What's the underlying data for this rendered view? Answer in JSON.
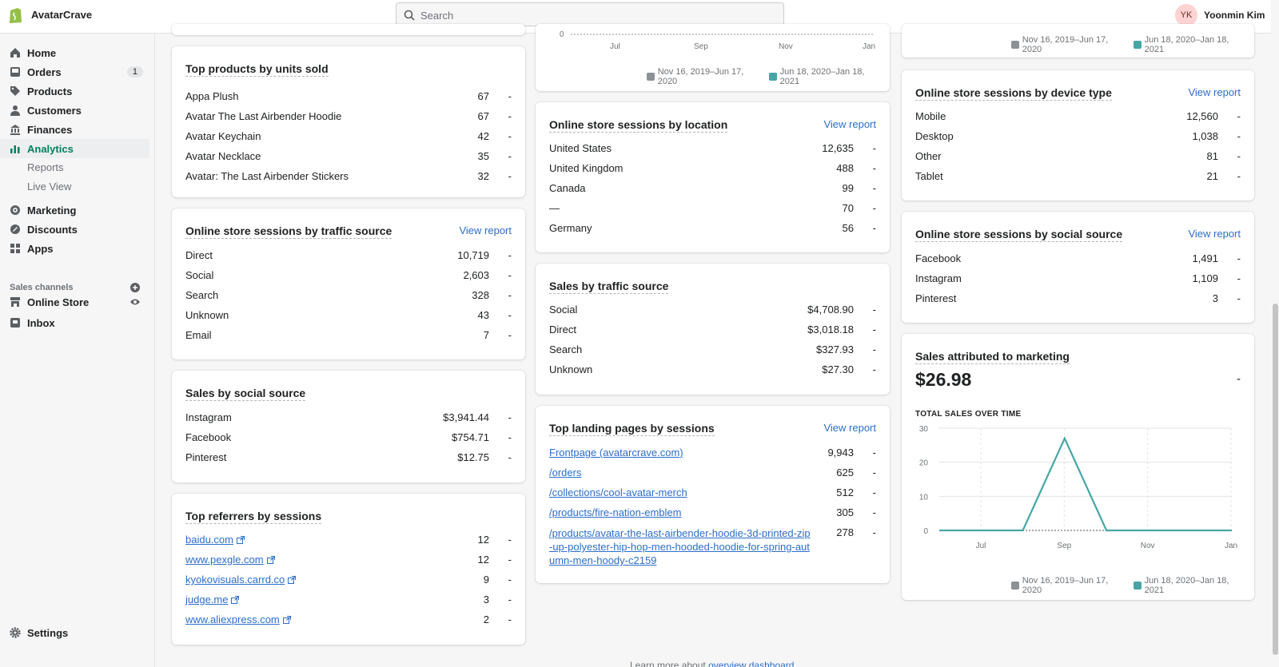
{
  "app": {
    "store_name": "AvatarCrave",
    "search_placeholder": "Search",
    "user_initials": "YK",
    "user_name": "Yoonmin Kim"
  },
  "sidebar": {
    "items": [
      {
        "label": "Home"
      },
      {
        "label": "Orders",
        "badge": "1"
      },
      {
        "label": "Products"
      },
      {
        "label": "Customers"
      },
      {
        "label": "Finances"
      },
      {
        "label": "Analytics"
      },
      {
        "label": "Marketing"
      },
      {
        "label": "Discounts"
      },
      {
        "label": "Apps"
      }
    ],
    "analytics_sub": [
      "Reports",
      "Live View"
    ],
    "channels_header": "Sales channels",
    "channels": [
      {
        "label": "Online Store"
      },
      {
        "label": "Inbox"
      }
    ],
    "settings": "Settings"
  },
  "common": {
    "view_report": "View report",
    "dash": "-"
  },
  "legend": {
    "prev": "Nov 16, 2019–Jun 17, 2020",
    "curr": "Jun 18, 2020–Jan 18, 2021",
    "prev_color": "#8c9196",
    "curr_color": "#47a5a5"
  },
  "top_chart": {
    "y_zero": "0",
    "x_ticks": [
      "Jul",
      "Sep",
      "Nov",
      "Jan"
    ]
  },
  "top_products": {
    "title": "Top products by units sold",
    "rows": [
      {
        "name": "Appa Plush",
        "value": "67"
      },
      {
        "name": "Avatar The Last Airbender Hoodie",
        "value": "67"
      },
      {
        "name": "Avatar Keychain",
        "value": "42"
      },
      {
        "name": "Avatar Necklace",
        "value": "35"
      },
      {
        "name": "Avatar: The Last Airbender Stickers",
        "value": "32"
      }
    ]
  },
  "traffic_sessions": {
    "title": "Online store sessions by traffic source",
    "rows": [
      {
        "name": "Direct",
        "value": "10,719"
      },
      {
        "name": "Social",
        "value": "2,603"
      },
      {
        "name": "Search",
        "value": "328"
      },
      {
        "name": "Unknown",
        "value": "43"
      },
      {
        "name": "Email",
        "value": "7"
      }
    ]
  },
  "social_sales": {
    "title": "Sales by social source",
    "rows": [
      {
        "name": "Instagram",
        "value": "$3,941.44"
      },
      {
        "name": "Facebook",
        "value": "$754.71"
      },
      {
        "name": "Pinterest",
        "value": "$12.75"
      }
    ]
  },
  "referrers": {
    "title": "Top referrers by sessions",
    "rows": [
      {
        "name": "baidu.com",
        "value": "12"
      },
      {
        "name": "www.pexgle.com",
        "value": "12"
      },
      {
        "name": "kyokovisuals.carrd.co",
        "value": "9"
      },
      {
        "name": "judge.me",
        "value": "3"
      },
      {
        "name": "www.aliexpress.com",
        "value": "2"
      }
    ]
  },
  "location_sessions": {
    "title": "Online store sessions by location",
    "rows": [
      {
        "name": "United States",
        "value": "12,635"
      },
      {
        "name": "United Kingdom",
        "value": "488"
      },
      {
        "name": "Canada",
        "value": "99"
      },
      {
        "name": "—",
        "value": "70"
      },
      {
        "name": "Germany",
        "value": "56"
      }
    ]
  },
  "traffic_sales": {
    "title": "Sales by traffic source",
    "rows": [
      {
        "name": "Social",
        "value": "$4,708.90"
      },
      {
        "name": "Direct",
        "value": "$3,018.18"
      },
      {
        "name": "Search",
        "value": "$327.93"
      },
      {
        "name": "Unknown",
        "value": "$27.30"
      }
    ]
  },
  "landing_pages": {
    "title": "Top landing pages by sessions",
    "rows": [
      {
        "name": "Frontpage (avatarcrave.com)",
        "value": "9,943"
      },
      {
        "name": "/orders",
        "value": "625"
      },
      {
        "name": "/collections/cool-avatar-merch",
        "value": "512"
      },
      {
        "name": "/products/fire-nation-emblem",
        "value": "305"
      },
      {
        "name": "/products/avatar-the-last-airbender-hoodie-3d-printed-zip-up-polyester-hip-hop-men-hooded-hoodie-for-spring-autumn-men-hoody-c2159",
        "lines": [
          "/products/avatar-the-last-airbender-hoodie-3d-printed-zip",
          "-up-polyester-hip-hop-men-hooded-hoodie-for-spring-aut",
          "umn-men-hoody-c2159"
        ],
        "value": "278"
      }
    ]
  },
  "device_sessions": {
    "title": "Online store sessions by device type",
    "rows": [
      {
        "name": "Mobile",
        "value": "12,560"
      },
      {
        "name": "Desktop",
        "value": "1,038"
      },
      {
        "name": "Other",
        "value": "81"
      },
      {
        "name": "Tablet",
        "value": "21"
      }
    ]
  },
  "social_sessions": {
    "title": "Online store sessions by social source",
    "rows": [
      {
        "name": "Facebook",
        "value": "1,491"
      },
      {
        "name": "Instagram",
        "value": "1,109"
      },
      {
        "name": "Pinterest",
        "value": "3"
      }
    ]
  },
  "marketing": {
    "title": "Sales attributed to marketing",
    "total": "$26.98",
    "change": "-",
    "chart_title": "TOTAL SALES OVER TIME"
  },
  "chart_data": {
    "type": "line",
    "title": "TOTAL SALES OVER TIME",
    "x_ticks": [
      "Jul",
      "Sep",
      "Nov",
      "Jan"
    ],
    "y_ticks": [
      "0",
      "10",
      "20",
      "30"
    ],
    "ylim": [
      0,
      30
    ],
    "series": [
      {
        "name": "Jun 18, 2020–Jan 18, 2021",
        "color": "#47a5a5",
        "x": [
          0,
          1,
          2,
          3,
          4,
          5,
          6,
          7
        ],
        "values": [
          0,
          0,
          0,
          27,
          0,
          0,
          0,
          0
        ]
      },
      {
        "name": "Nov 16, 2019–Jun 17, 2020",
        "color": "#8c9196",
        "x": [
          0,
          1,
          2,
          3,
          4,
          5,
          6,
          7
        ],
        "values": [
          0,
          0,
          0,
          0,
          0,
          0,
          0,
          0
        ]
      }
    ]
  },
  "footer": {
    "text": "Learn more about ",
    "link": "overview dashboard"
  }
}
